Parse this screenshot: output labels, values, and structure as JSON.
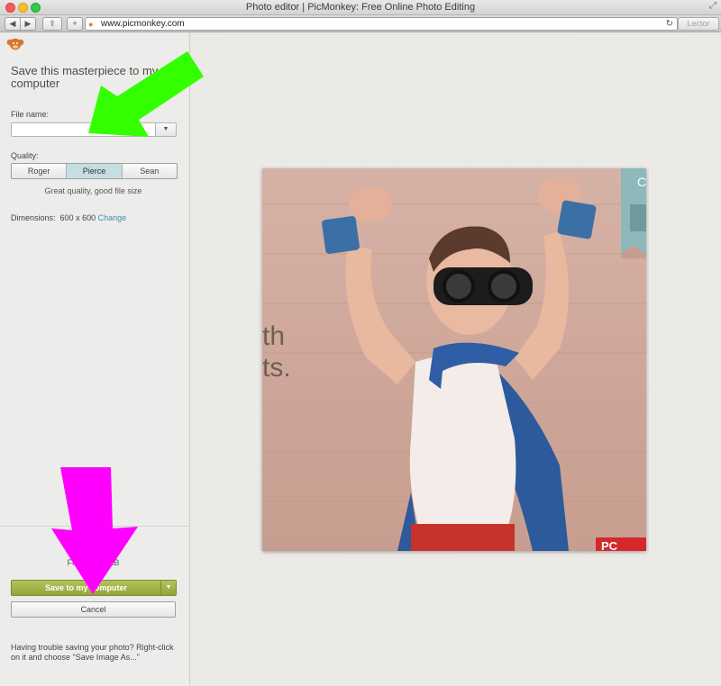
{
  "window": {
    "title": "Photo editor | PicMonkey: Free Online Photo Editing",
    "url": "www.picmonkey.com",
    "reader_label": "Lector"
  },
  "panel": {
    "heading": "Save this masterpiece to my computer",
    "file_name_label": "File name:",
    "file_name_value": "",
    "quality_label": "Quality:",
    "quality_options": [
      "Roger",
      "Pierce",
      "Sean"
    ],
    "quality_selected": "Pierce",
    "quality_description": "Great quality, good file size",
    "dimensions_label": "Dimensions:",
    "dimensions_value": "600 x 600",
    "change_link": "Change",
    "file_size_text": "File size: ~ KB",
    "save_button": "Save to my computer",
    "cancel_button": "Cancel",
    "help_text": "Having trouble saving your photo? Right-click on it and choose \"Save Image As...\""
  },
  "photo": {
    "overlay_text_lines": [
      "th",
      "ts."
    ],
    "corner_letter": "C",
    "bottom_corner_text": "PC"
  },
  "colors": {
    "save_button": "#9fae40",
    "selected_quality": "#c6dde2",
    "link": "#3d8fa8",
    "arrow_green": "#33ff00",
    "arrow_magenta": "#ff00ff"
  },
  "icons": {
    "logo": "monkey-logo-icon",
    "back": "back-arrow-icon",
    "forward": "forward-arrow-icon",
    "share": "share-icon",
    "add_tab": "plus-icon",
    "reload": "reload-icon"
  }
}
